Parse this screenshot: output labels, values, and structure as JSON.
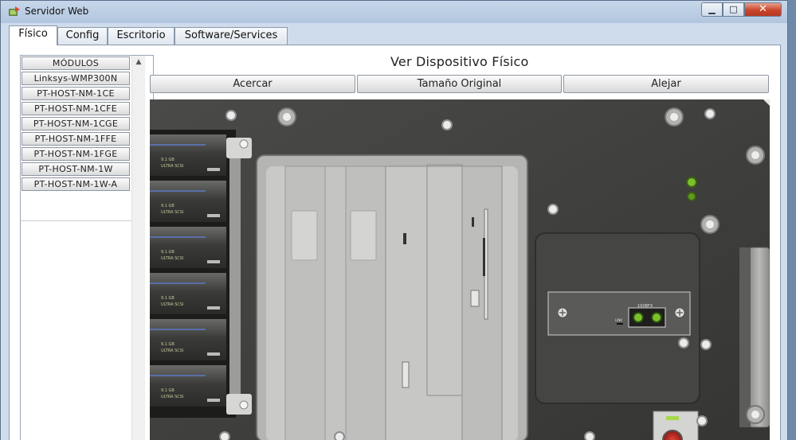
{
  "window": {
    "title": "Servidor Web",
    "minimize": "▁",
    "maximize": "□",
    "close": "✕"
  },
  "tabs": [
    {
      "label": "Físico",
      "active": true
    },
    {
      "label": "Config",
      "active": false
    },
    {
      "label": "Escritorio",
      "active": false
    },
    {
      "label": "Software/Services",
      "active": false
    }
  ],
  "modules": {
    "header": "MÓDULOS",
    "items": [
      "Linksys-WMP300N",
      "PT-HOST-NM-1CE",
      "PT-HOST-NM-1CFE",
      "PT-HOST-NM-1CGE",
      "PT-HOST-NM-1FFE",
      "PT-HOST-NM-1FGE",
      "PT-HOST-NM-1W",
      "PT-HOST-NM-1W-A"
    ]
  },
  "view": {
    "title": "Ver Dispositivo Físico",
    "zoom_in": "Acercar",
    "original_size": "Tamaño Original",
    "zoom_out": "Alejar"
  },
  "device": {
    "disk_labels": [
      "9.1 GB",
      "ULTRA SCSI"
    ],
    "port_label": "100BFX",
    "link_label": "LINK",
    "colors": {
      "chassis": "#3a3a38",
      "led_green": "#7ac02a",
      "power_button": "#c0241a",
      "bezel": "#9a9a98"
    }
  }
}
